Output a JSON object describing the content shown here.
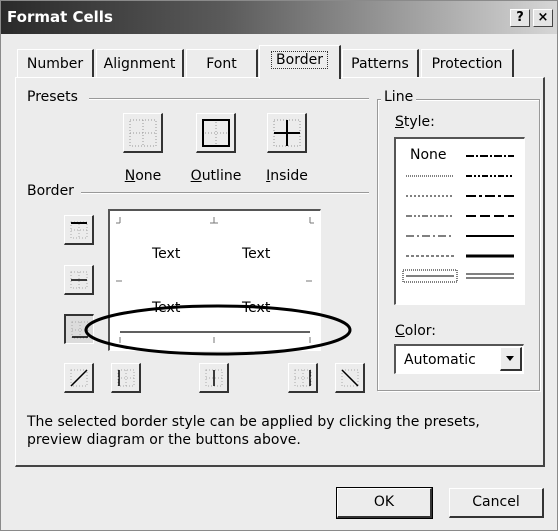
{
  "window": {
    "title": "Format Cells",
    "help_label": "?",
    "close_label": "×"
  },
  "tabs": [
    {
      "label": "Number"
    },
    {
      "label": "Alignment"
    },
    {
      "label": "Font"
    },
    {
      "label": "Border",
      "active": true
    },
    {
      "label": "Patterns"
    },
    {
      "label": "Protection"
    }
  ],
  "presets": {
    "label": "Presets",
    "items": [
      {
        "label": "None",
        "underline": "N",
        "rest": "one"
      },
      {
        "label": "Outline",
        "underline": "O",
        "rest": "utline"
      },
      {
        "label": "Inside",
        "underline": "I",
        "rest": "nside"
      }
    ]
  },
  "border": {
    "label": "Border"
  },
  "preview": {
    "cells": [
      "Text",
      "Text",
      "Text",
      "Text"
    ]
  },
  "line": {
    "label": "Line",
    "style_label": "Style:",
    "style_underline": "S",
    "style_rest": "tyle:",
    "none_label": "None",
    "color_label": "Color:",
    "color_underline": "C",
    "color_rest": "olor:",
    "color_value": "Automatic"
  },
  "help_text": "The selected border style can be applied by clicking the presets, preview diagram or the buttons above.",
  "buttons": {
    "ok": "OK",
    "cancel": "Cancel"
  }
}
